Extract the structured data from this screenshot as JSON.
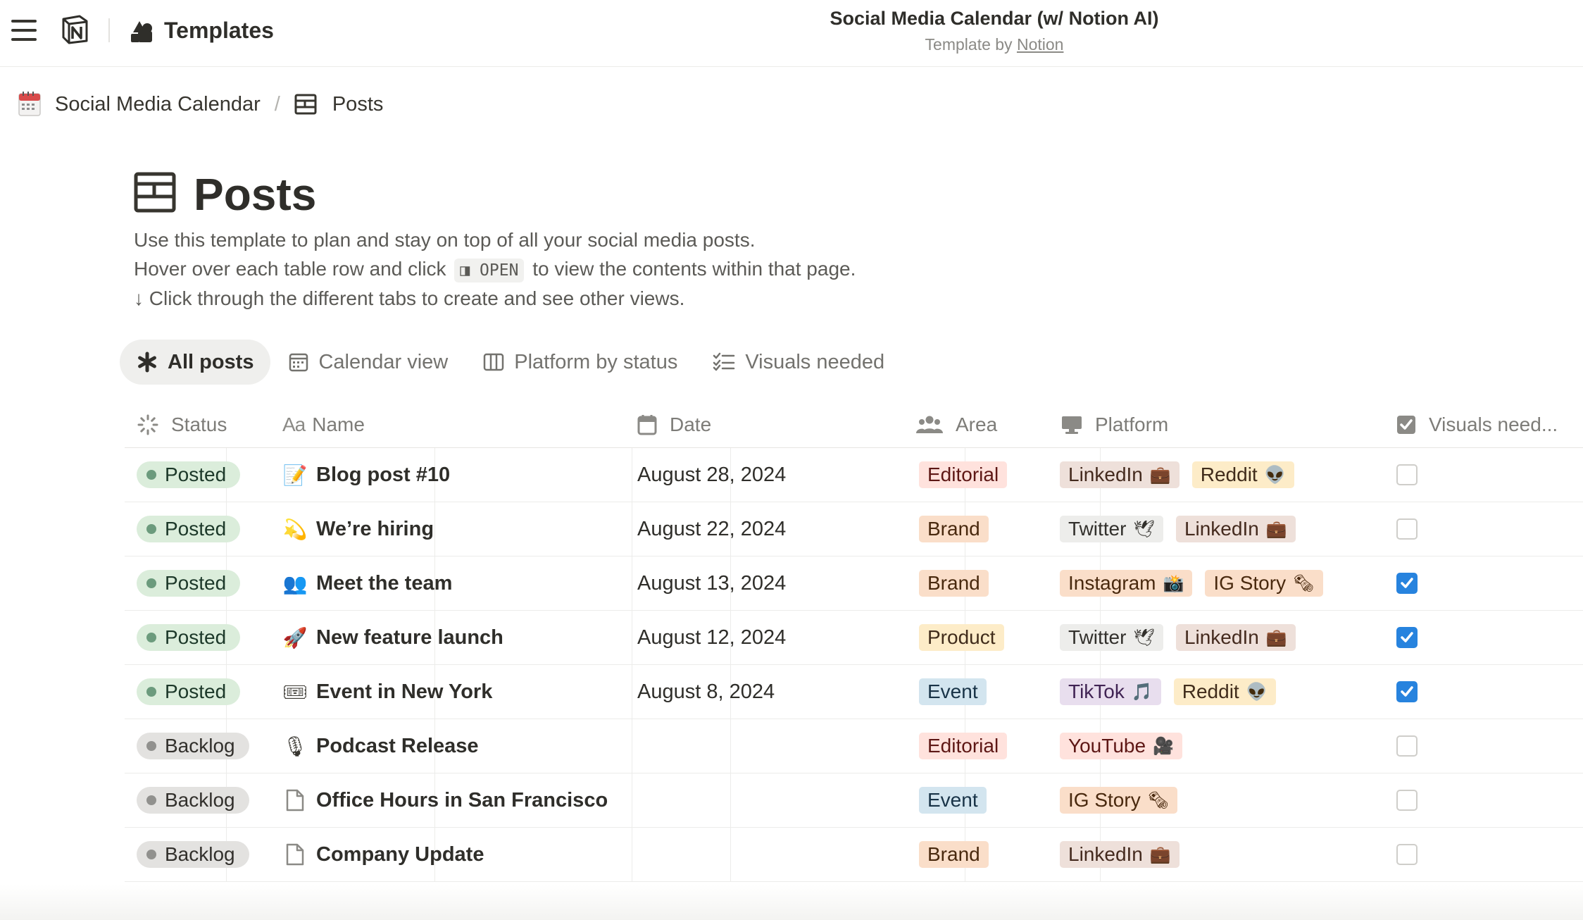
{
  "app": {
    "templates_label": "Templates",
    "title": "Social Media Calendar (w/ Notion AI)",
    "subtitle_prefix": "Template by",
    "subtitle_link": "Notion"
  },
  "breadcrumb": [
    {
      "label": "Social Media Calendar",
      "icon": "calendar-emoji-icon"
    },
    {
      "label": "Posts",
      "icon": "database-table-icon"
    }
  ],
  "page": {
    "title": "Posts",
    "desc_line1": "Use this template to plan and stay on top of all your social media posts.",
    "desc_line2_pre": "Hover over each table row and click",
    "desc_code": "◨ OPEN",
    "desc_line2_post": "to view the contents within that page.",
    "desc_line3": "↓ Click through the different tabs to create and see other views."
  },
  "tabs": [
    {
      "label": "All posts",
      "icon": "asterisk-icon",
      "active": true
    },
    {
      "label": "Calendar view",
      "icon": "calendar-icon",
      "active": false
    },
    {
      "label": "Platform by status",
      "icon": "board-columns-icon",
      "active": false
    },
    {
      "label": "Visuals needed",
      "icon": "checklist-icon",
      "active": false
    }
  ],
  "columns": {
    "status": "Status",
    "name": "Name",
    "date": "Date",
    "area": "Area",
    "platform": "Platform",
    "visuals": "Visuals need..."
  },
  "rows": [
    {
      "status": "Posted",
      "emoji": "📝",
      "name": "Blog post #10",
      "date": "August 28, 2024",
      "area": "Editorial",
      "platforms": [
        {
          "label": "LinkedIn",
          "emoji": "💼"
        },
        {
          "label": "Reddit",
          "emoji": "👽"
        }
      ],
      "visuals": false
    },
    {
      "status": "Posted",
      "emoji": "💫",
      "name": "We’re hiring",
      "date": "August 22, 2024",
      "area": "Brand",
      "platforms": [
        {
          "label": "Twitter",
          "emoji": "🕊"
        },
        {
          "label": "LinkedIn",
          "emoji": "💼"
        }
      ],
      "visuals": false
    },
    {
      "status": "Posted",
      "emoji": "👥",
      "name": "Meet the team",
      "date": "August 13, 2024",
      "area": "Brand",
      "platforms": [
        {
          "label": "Instagram",
          "emoji": "📸"
        },
        {
          "label": "IG Story",
          "emoji": "🗞"
        }
      ],
      "visuals": true
    },
    {
      "status": "Posted",
      "emoji": "🚀",
      "name": "New feature launch",
      "date": "August 12, 2024",
      "area": "Product",
      "platforms": [
        {
          "label": "Twitter",
          "emoji": "🕊"
        },
        {
          "label": "LinkedIn",
          "emoji": "💼"
        }
      ],
      "visuals": true
    },
    {
      "status": "Posted",
      "emoji": "🎟",
      "name": "Event in New York",
      "date": "August 8, 2024",
      "area": "Event",
      "platforms": [
        {
          "label": "TikTok",
          "emoji": "🎵"
        },
        {
          "label": "Reddit",
          "emoji": "👽"
        }
      ],
      "visuals": true
    },
    {
      "status": "Backlog",
      "emoji": "🎙",
      "name": "Podcast Release",
      "date": "",
      "area": "Editorial",
      "platforms": [
        {
          "label": "YouTube",
          "emoji": "🎥"
        }
      ],
      "visuals": false
    },
    {
      "status": "Backlog",
      "emoji": "",
      "name": "Office Hours in San Francisco",
      "date": "",
      "area": "Event",
      "platforms": [
        {
          "label": "IG Story",
          "emoji": "🗞"
        }
      ],
      "visuals": false
    },
    {
      "status": "Backlog",
      "emoji": "",
      "name": "Company Update",
      "date": "",
      "area": "Brand",
      "platforms": [
        {
          "label": "LinkedIn",
          "emoji": "💼"
        }
      ],
      "visuals": false
    }
  ],
  "colors": {
    "posted_bg": "#dbeddb",
    "posted_text": "#1c3829",
    "posted_dot": "#6c9b7d",
    "backlog_bg": "#e3e2e0",
    "backlog_text": "#32302c",
    "backlog_dot": "#91918e",
    "area": {
      "Editorial": {
        "bg": "#ffe2dd",
        "fg": "#5d1715"
      },
      "Brand": {
        "bg": "#fadec9",
        "fg": "#49290e"
      },
      "Product": {
        "bg": "#fdecc8",
        "fg": "#402c1b"
      },
      "Event": {
        "bg": "#d3e5ef",
        "fg": "#183347"
      }
    },
    "platform": {
      "LinkedIn": {
        "bg": "#eee0da",
        "fg": "#442a1e"
      },
      "Reddit": {
        "bg": "#fdecc8",
        "fg": "#402c1b"
      },
      "Twitter": {
        "bg": "#ededeb",
        "fg": "#32302c"
      },
      "Instagram": {
        "bg": "#fadec9",
        "fg": "#49290e"
      },
      "IG Story": {
        "bg": "#fadec9",
        "fg": "#49290e"
      },
      "TikTok": {
        "bg": "#e8deee",
        "fg": "#412454"
      },
      "YouTube": {
        "bg": "#ffe2dd",
        "fg": "#5d1715"
      }
    },
    "checkbox_on": "#2783de"
  }
}
